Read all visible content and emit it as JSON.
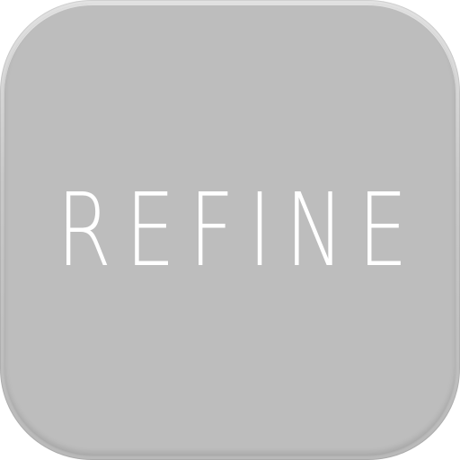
{
  "app_icon": {
    "wordmark": "REFINE",
    "colors": {
      "tile_face": "#bdbdbd",
      "tile_rim_light": "#e2e2e2",
      "tile_rim_dark": "#b9b9b9",
      "text": "#ffffff"
    }
  }
}
